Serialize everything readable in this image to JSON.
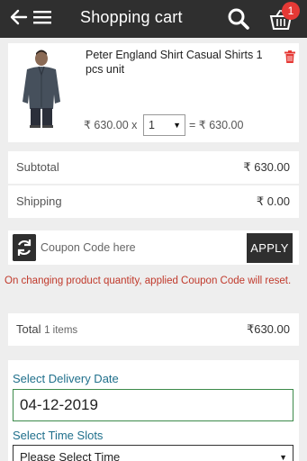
{
  "header": {
    "title": "Shopping cart",
    "cart_count": "1",
    "icons": [
      "back-arrow-icon",
      "menu-icon",
      "search-icon",
      "cart-icon"
    ],
    "background": "#2f2f2f"
  },
  "cart_item": {
    "name": "Peter England Shirt Casual Shirts 1 pcs unit",
    "unit_price": "₹ 630.00 x",
    "quantity": "1",
    "line_total": "= ₹ 630.00",
    "delete_icon": "trash-icon"
  },
  "summary": {
    "subtotal_label": "Subtotal",
    "subtotal_value": "₹ 630.00",
    "shipping_label": "Shipping",
    "shipping_value": "₹ 0.00"
  },
  "coupon": {
    "placeholder": "Coupon Code here",
    "apply_label": "APPLY",
    "note": "On changing product quantity, applied Coupon Code will reset."
  },
  "total": {
    "label": "Total",
    "items": "1 items",
    "value": "₹630.00"
  },
  "delivery": {
    "date_label": "Select Delivery Date",
    "date_value": "04-12-2019",
    "slot_label": "Select Time Slots",
    "slot_value": "Please Select Time"
  },
  "colors": {
    "accent_text": "#1f6f8b",
    "warning": "#c0392b",
    "badge": "#e53935"
  }
}
